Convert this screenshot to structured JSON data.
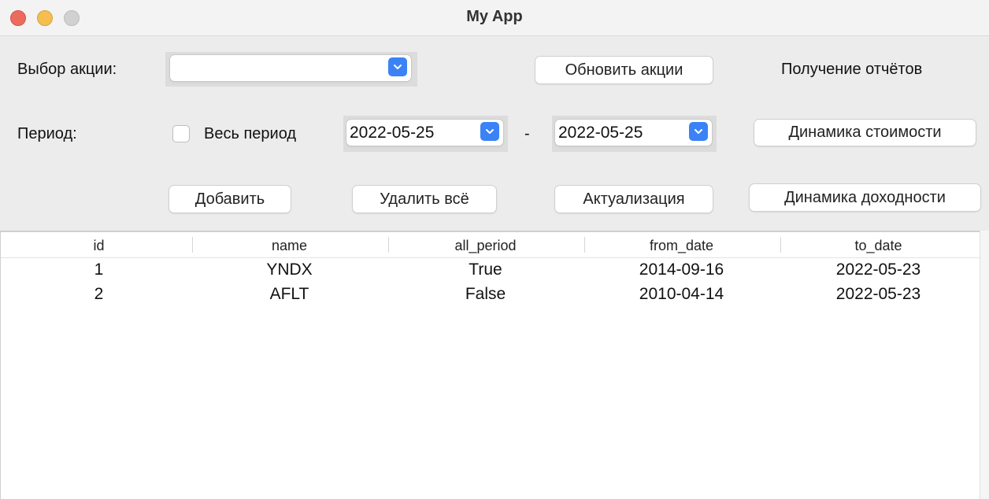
{
  "window": {
    "title": "My App"
  },
  "form": {
    "stock_label": "Выбор акции:",
    "stock_value": "",
    "update_button": "Обновить акции",
    "reports_label": "Получение отчётов",
    "period_label": "Период:",
    "all_period_label": "Весь период",
    "all_period_checked": false,
    "from_date": "2022-05-25",
    "dash": "-",
    "to_date": "2022-05-25",
    "price_dynamics_button": "Динамика стоимости",
    "add_button": "Добавить",
    "delete_all_button": "Удалить всё",
    "actualize_button": "Актуализация",
    "yield_dynamics_button": "Динамика доходности"
  },
  "table": {
    "columns": [
      "id",
      "name",
      "all_period",
      "from_date",
      "to_date"
    ],
    "rows": [
      [
        "1",
        "YNDX",
        "True",
        "2014-09-16",
        "2022-05-23"
      ],
      [
        "2",
        "AFLT",
        "False",
        "2010-04-14",
        "2022-05-23"
      ]
    ]
  },
  "colors": {
    "accent": "#3b82f6",
    "close": "#ed6a5e",
    "minimize": "#f4bf4f",
    "maximize": "#d1d1d1"
  }
}
